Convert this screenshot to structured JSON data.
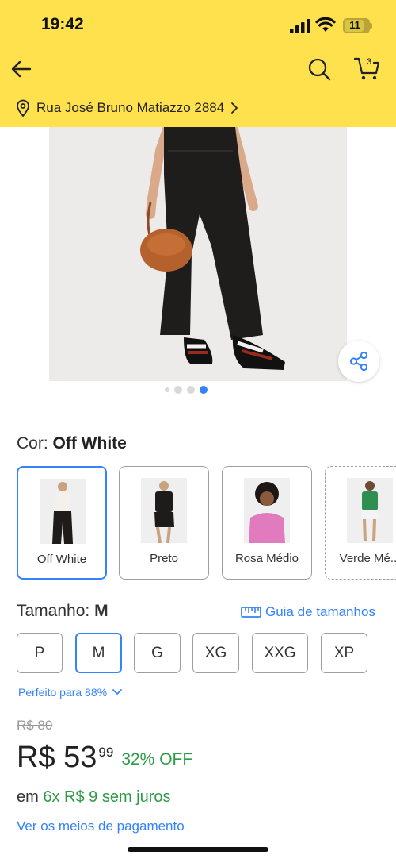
{
  "status_bar": {
    "time": "19:42",
    "battery": "11"
  },
  "header": {
    "cart_count": "3",
    "address": "Rua José Bruno Matiazzo 2884",
    "background": "#ffe14d"
  },
  "gallery": {
    "total_images": 4,
    "active_index": 4
  },
  "color": {
    "label": "Cor:",
    "selected": "Off White",
    "options": [
      {
        "label": "Off White"
      },
      {
        "label": "Preto"
      },
      {
        "label": "Rosa Médio"
      },
      {
        "label": "Verde Mé..."
      }
    ]
  },
  "size": {
    "label": "Tamanho:",
    "selected": "M",
    "guide": "Guia de tamanhos",
    "options": [
      "P",
      "M",
      "G",
      "XG",
      "XXG",
      "XP"
    ],
    "fit": "Perfeito para 88%"
  },
  "price": {
    "old": "R$ 80",
    "main": "R$ 53",
    "cents": "99",
    "discount": "32% OFF",
    "installments_prefix": "em",
    "installments_value": "6x R$ 9 sem juros",
    "payment_link": "Ver os meios de pagamento"
  },
  "colors": {
    "accent": "#3483fa",
    "green": "#2e9c47"
  }
}
